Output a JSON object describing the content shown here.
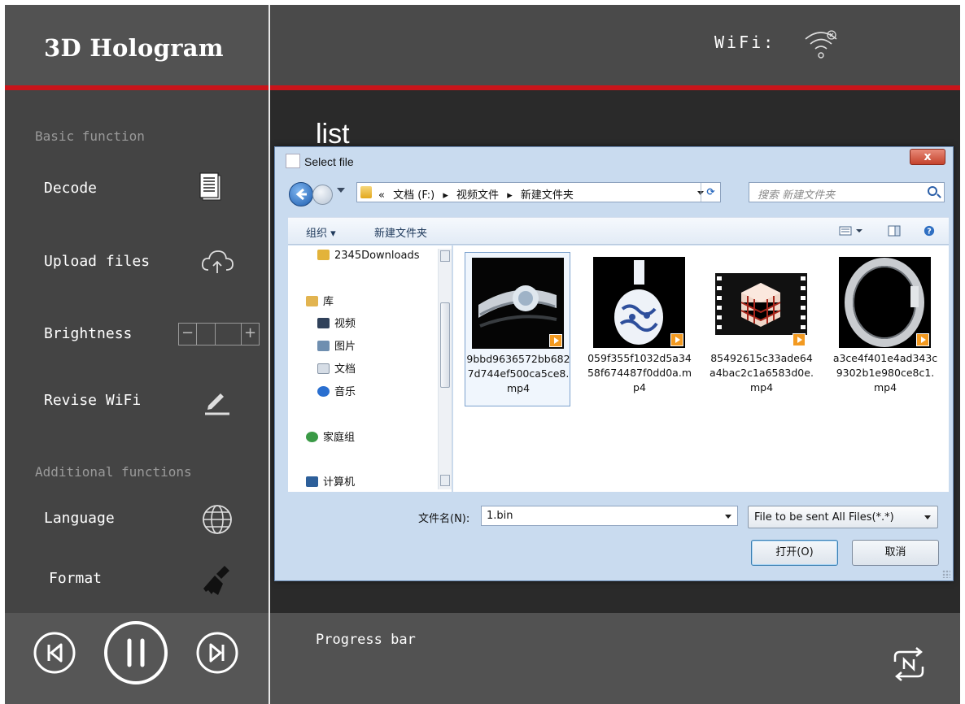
{
  "app": {
    "title": "3D  Hologram",
    "wifi_label": "WiFi:",
    "wifi_icon": "wifi-disconnected-icon",
    "accent_color": "#c8141a"
  },
  "sidebar": {
    "basic_section": "Basic function",
    "additional_section": "Additional functions",
    "items": [
      {
        "label": "Decode",
        "icon": "document-icon"
      },
      {
        "label": "Upload files",
        "icon": "cloud-upload-icon"
      },
      {
        "label": "Brightness",
        "icon": "brightness-stepper"
      },
      {
        "label": "Revise WiFi",
        "icon": "pencil-icon"
      },
      {
        "label": "Language",
        "icon": "globe-icon"
      },
      {
        "label": "Format",
        "icon": "broom-icon"
      }
    ],
    "brightness": {
      "minus": "−",
      "plus": "+"
    }
  },
  "main": {
    "list_title": "list"
  },
  "dialog": {
    "title": "Select file",
    "close": "x",
    "breadcrumbs": [
      "«",
      "文档 (F:)",
      "▸",
      "视频文件",
      "▸",
      "新建文件夹"
    ],
    "search_placeholder": "搜索 新建文件夹",
    "toolbar": {
      "organize": "组织 ▾",
      "new_folder": "新建文件夹"
    },
    "nav_items": [
      {
        "label": "2345Downloads",
        "color": "#e3b33a"
      },
      {
        "label": "库",
        "color": "#e2b450"
      },
      {
        "label": "视频",
        "color": "#30415a"
      },
      {
        "label": "图片",
        "color": "#6f8fb0"
      },
      {
        "label": "文档",
        "color": "#d6dde6"
      },
      {
        "label": "音乐",
        "color": "#2a6fd0"
      },
      {
        "label": "家庭组",
        "color": "#3a9a46"
      },
      {
        "label": "计算机",
        "color": "#2d5f9a"
      }
    ],
    "files": [
      {
        "name": "9bbd9636572bb6827d744ef500ca5ce8.mp4",
        "selected": true
      },
      {
        "name": "059f355f1032d5a3458f674487f0dd0a.mp4",
        "selected": false
      },
      {
        "name": "85492615c33ade64a4bac2c1a6583d0e.mp4",
        "selected": false
      },
      {
        "name": "a3ce4f401e4ad343c9302b1e980ce8c1.mp4",
        "selected": false
      }
    ],
    "filename_label": "文件名(N):",
    "filename_value": "1.bin",
    "filetype_value": "File to be sent All Files(*.*)",
    "open_button": "打开(O)",
    "cancel_button": "取消"
  },
  "player": {
    "progress_label": "Progress bar",
    "prev_icon": "skip-previous-icon",
    "pause_icon": "pause-icon",
    "next_icon": "skip-next-icon",
    "repeat_icon": "repeat-n-icon"
  }
}
